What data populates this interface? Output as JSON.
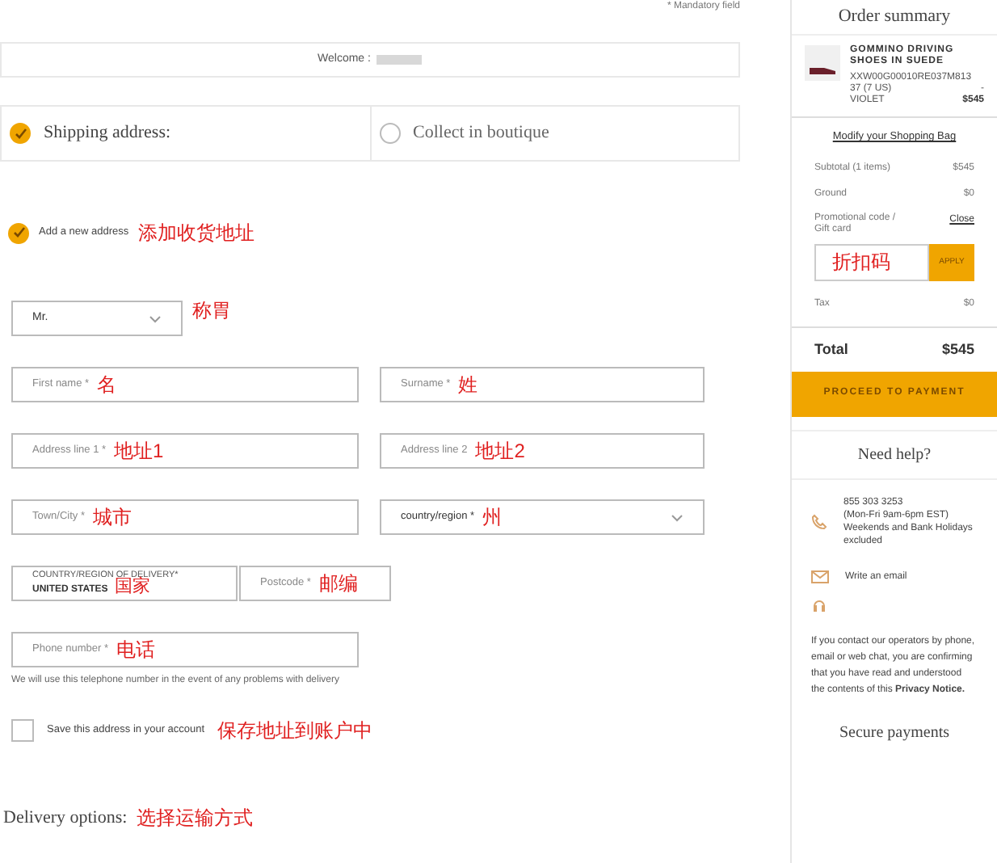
{
  "mandatory_note": "* Mandatory field",
  "welcome": {
    "label": "Welcome :"
  },
  "delivery_choice": [
    {
      "label": "Shipping address:",
      "selected": true
    },
    {
      "label": "Collect in boutique",
      "selected": false
    }
  ],
  "add_address": {
    "label": "Add a new address",
    "checked": true,
    "annotation": "添加收货地址"
  },
  "title_select": {
    "value": "Mr.",
    "annotation": "称胃"
  },
  "field_rows": [
    [
      {
        "kind": "input",
        "placeholder": "First name *",
        "annotation": "名"
      },
      {
        "kind": "input",
        "placeholder": "Surname *",
        "annotation": "姓"
      }
    ],
    [
      {
        "kind": "input",
        "placeholder": "Address line 1 *",
        "annotation": "地址1"
      },
      {
        "kind": "input",
        "placeholder": "Address line 2",
        "annotation": "地址2"
      }
    ],
    [
      {
        "kind": "input",
        "placeholder": "Town/City *",
        "annotation": "城市"
      },
      {
        "kind": "select",
        "placeholder": "country/region *",
        "annotation": "州"
      }
    ],
    [
      {
        "kind": "value",
        "placeholder": "COUNTRY/REGION OF DELIVERY*",
        "value": "UNITED STATES",
        "annotation": "国家"
      },
      {
        "kind": "input",
        "placeholder": "Postcode *",
        "annotation": "邮编"
      }
    ],
    [
      {
        "kind": "input",
        "placeholder": "Phone number *",
        "annotation": "电话"
      }
    ]
  ],
  "phone_hint": "We will use this telephone number in the event of any problems with delivery",
  "save_address": {
    "label": "Save this address in your account",
    "checked": false,
    "annotation": "保存地址到账户中"
  },
  "delivery_options": {
    "label": "Delivery options:",
    "annotation": "选择运输方式"
  },
  "order_summary": {
    "title": "Order summary",
    "product": {
      "name": "GOMMINO DRIVING SHOES IN SUEDE",
      "sku": "XXW00G00010RE037M813",
      "size": "37 (7 US)",
      "size_extra": "-",
      "variant": "VIOLET",
      "price": "$545"
    },
    "modify_link": "Modify your Shopping Bag",
    "lines": [
      {
        "label": "Subtotal (1 items)",
        "value": "$545"
      },
      {
        "label": "Ground",
        "value": "$0"
      }
    ],
    "promo": {
      "label": "Promotional code / Gift card",
      "close": "Close",
      "annotation": "折扣码",
      "apply": "APPLY"
    },
    "tax": {
      "label": "Tax",
      "value": "$0"
    },
    "total": {
      "label": "Total",
      "value": "$545"
    },
    "proceed": "PROCEED TO PAYMENT"
  },
  "help": {
    "title": "Need help?",
    "phone": "855 303 3253",
    "hours": "(Mon-Fri 9am-6pm EST) Weekends and Bank Holidays excluded",
    "email": "Write an email",
    "notice": "If you contact our operators by phone, email or web chat, you are confirming that you have read and understood the contents of this",
    "notice_link": "Privacy Notice."
  },
  "secure_payments": "Secure payments"
}
